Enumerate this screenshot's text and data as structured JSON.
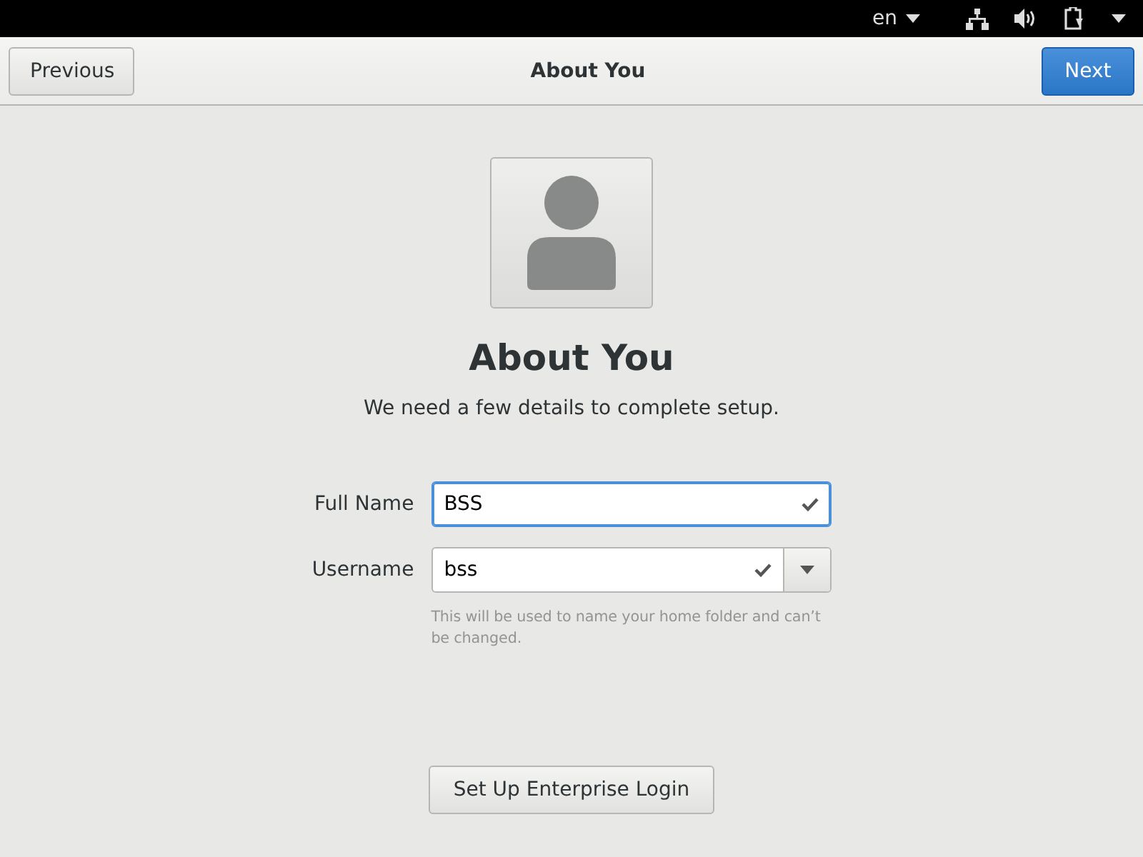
{
  "top_bar": {
    "language": "en"
  },
  "header": {
    "title": "About You",
    "previous_button": "Previous",
    "next_button": "Next"
  },
  "page": {
    "heading": "About You",
    "subtitle": "We need a few details to complete setup.",
    "fields": [
      {
        "label": "Full Name",
        "value": "BSS",
        "focused": true,
        "dropdown": false
      },
      {
        "label": "Username",
        "value": "bss",
        "focused": false,
        "dropdown": true
      }
    ],
    "hint": "This will be used to name your home folder and can’t be changed.",
    "enterprise_button": "Set Up Enterprise Login"
  }
}
